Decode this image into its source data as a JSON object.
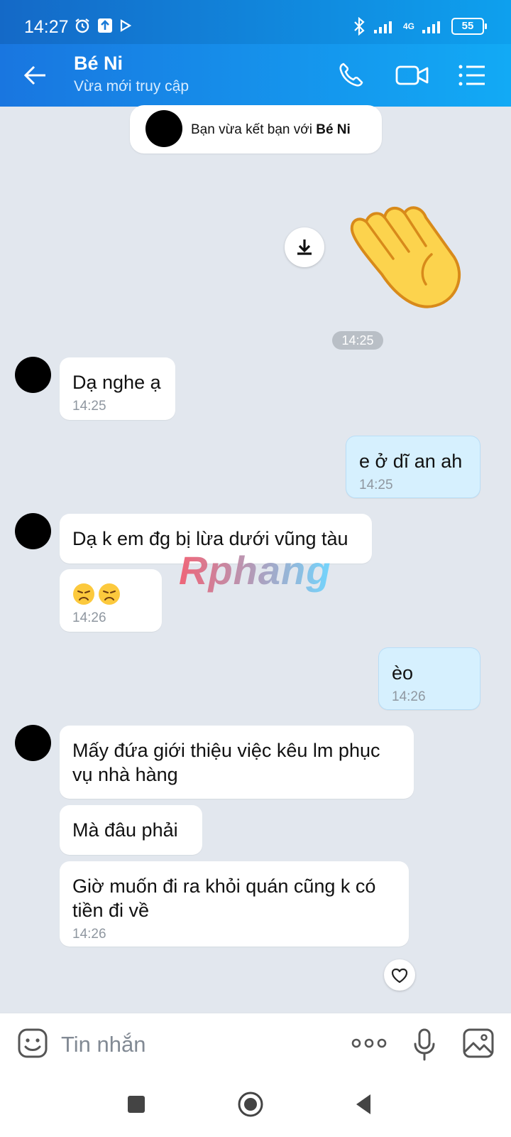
{
  "status_bar": {
    "time": "14:27",
    "network": "4G",
    "battery": "55"
  },
  "header": {
    "contact_name": "Bé Ni",
    "status": "Vừa mới truy cập"
  },
  "system_message": {
    "prefix": "Bạn vừa kết bạn với",
    "name": "Bé Ni"
  },
  "sticker": {
    "icon": "waving-hand-icon",
    "time": "14:25"
  },
  "messages": [
    {
      "sender": "contact",
      "text": "Dạ nghe ạ",
      "time": "14:25"
    },
    {
      "sender": "me",
      "text": "e ở dĩ an ah",
      "time": "14:25"
    },
    {
      "sender": "contact",
      "text": "Dạ k em đg bị lừa dưới vũng tàu",
      "time": ""
    },
    {
      "sender": "contact",
      "text": "😞😞",
      "time": "14:26"
    },
    {
      "sender": "me",
      "text": "èo",
      "time": "14:26"
    },
    {
      "sender": "contact",
      "text": "Mấy đứa giới thiệu việc kêu lm phục vụ nhà hàng",
      "time": ""
    },
    {
      "sender": "contact",
      "text": "Mà đâu phải",
      "time": ""
    },
    {
      "sender": "contact",
      "text": "Giờ muốn đi ra khỏi quán cũng k có tiền đi về",
      "time": "14:26"
    }
  ],
  "watermark": "Rphang",
  "composer": {
    "placeholder": "Tin nhắn"
  },
  "colors": {
    "header_start": "#1976e0",
    "header_end": "#12aaf5",
    "outgoing_bubble": "#d6f0fe",
    "background": "#e2e7ee"
  }
}
